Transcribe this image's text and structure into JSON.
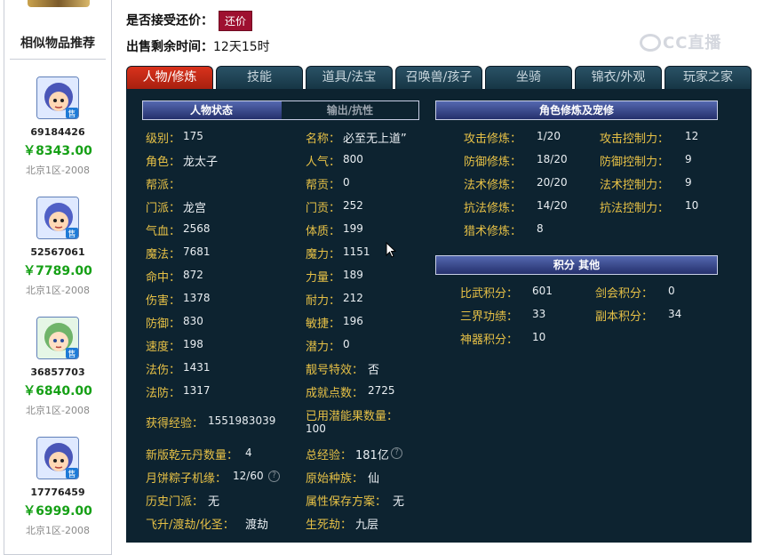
{
  "sidebar": {
    "title": "相似物品推荐",
    "items": [
      {
        "id": "69184426",
        "price": "￥8343.00",
        "server": "北京1区-2008",
        "badge": "售"
      },
      {
        "id": "52567061",
        "price": "￥7789.00",
        "server": "北京1区-2008",
        "badge": "售"
      },
      {
        "id": "36857703",
        "price": "￥6840.00",
        "server": "北京1区-2008",
        "badge": "售"
      },
      {
        "id": "17776459",
        "price": "￥6999.00",
        "server": "北京1区-2008",
        "badge": "售"
      }
    ]
  },
  "top": {
    "bargain_label": "是否接受还价：",
    "bargain_button": "还价",
    "time_label": "出售剩余时间：",
    "time_value": "12天15时"
  },
  "watermark": "CC直播",
  "tabs": [
    "人物/修炼",
    "技能",
    "道具/法宝",
    "召唤兽/孩子",
    "坐骑",
    "锦衣/外观",
    "玩家之家"
  ],
  "active_tab": 0,
  "left_section": {
    "subtabs": [
      "人物状态",
      "输出/抗性"
    ],
    "col1": [
      {
        "label": "级别：",
        "value": "175"
      },
      {
        "label": "角色：",
        "value": "龙太子"
      },
      {
        "label": "帮派：",
        "value": ""
      },
      {
        "label": "门派：",
        "value": "龙宫"
      },
      {
        "label": "气血：",
        "value": "2568"
      },
      {
        "label": "魔法：",
        "value": "7681"
      },
      {
        "label": "命中：",
        "value": "872"
      },
      {
        "label": "伤害：",
        "value": "1378"
      },
      {
        "label": "防御：",
        "value": "830"
      },
      {
        "label": "速度：",
        "value": "198"
      },
      {
        "label": "法伤：",
        "value": "1431"
      },
      {
        "label": "法防：",
        "value": "1317"
      }
    ],
    "col2": [
      {
        "label": "名称：",
        "value": "必至无上道”"
      },
      {
        "label": "人气：",
        "value": "800"
      },
      {
        "label": "帮贡：",
        "value": "0"
      },
      {
        "label": "门贡：",
        "value": "252"
      },
      {
        "label": "体质：",
        "value": "199"
      },
      {
        "label": "魔力：",
        "value": "1151"
      },
      {
        "label": "力量：",
        "value": "189"
      },
      {
        "label": "耐力：",
        "value": "212"
      },
      {
        "label": "敏捷：",
        "value": "196"
      },
      {
        "label": "潜力：",
        "value": "0"
      },
      {
        "label": "靓号特效：",
        "value": "否"
      },
      {
        "label": "成就点数：",
        "value": "2725"
      }
    ],
    "exp_label": "获得经验：",
    "exp_value": "1551983039",
    "potion_label": "已用潜能果数量：",
    "potion_value": "100",
    "bottom": [
      {
        "label": "新版乾元丹数量：",
        "value": "4"
      },
      {
        "label": "总经验：",
        "value": "181亿"
      },
      {
        "label": "月饼粽子机缘：",
        "value": "12/60"
      },
      {
        "label": "原始种族：",
        "value": "仙"
      },
      {
        "label": "历史门派：",
        "value": "无"
      },
      {
        "label": "属性保存方案：",
        "value": "无"
      },
      {
        "label": "飞升/渡劫/化圣：",
        "value": "渡劫"
      },
      {
        "label": "生死劫：",
        "value": "九层"
      }
    ]
  },
  "cultivation": {
    "title": "角色修炼及宠修",
    "rows": [
      {
        "l1": "攻击修炼：",
        "v1": "1/20",
        "l2": "攻击控制力：",
        "v2": "12"
      },
      {
        "l1": "防御修炼：",
        "v1": "18/20",
        "l2": "防御控制力：",
        "v2": "9"
      },
      {
        "l1": "法术修炼：",
        "v1": "20/20",
        "l2": "法术控制力：",
        "v2": "9"
      },
      {
        "l1": "抗法修炼：",
        "v1": "14/20",
        "l2": "抗法控制力：",
        "v2": "10"
      },
      {
        "l1": "猎术修炼：",
        "v1": "8",
        "l2": "",
        "v2": ""
      }
    ]
  },
  "points": {
    "title": "积分  其他",
    "rows": [
      {
        "l1": "比武积分：",
        "v1": "601",
        "l2": "剑会积分：",
        "v2": "0"
      },
      {
        "l1": "三界功绩：",
        "v1": "33",
        "l2": "副本积分：",
        "v2": "34"
      },
      {
        "l1": "神器积分：",
        "v1": "10",
        "l2": "",
        "v2": ""
      }
    ]
  },
  "help_icon": "?",
  "colors": {
    "label": "#e7c146",
    "value": "#e9eef2",
    "panel": "#0d2330",
    "active_tab": "#d9321c",
    "price": "#16a016"
  }
}
